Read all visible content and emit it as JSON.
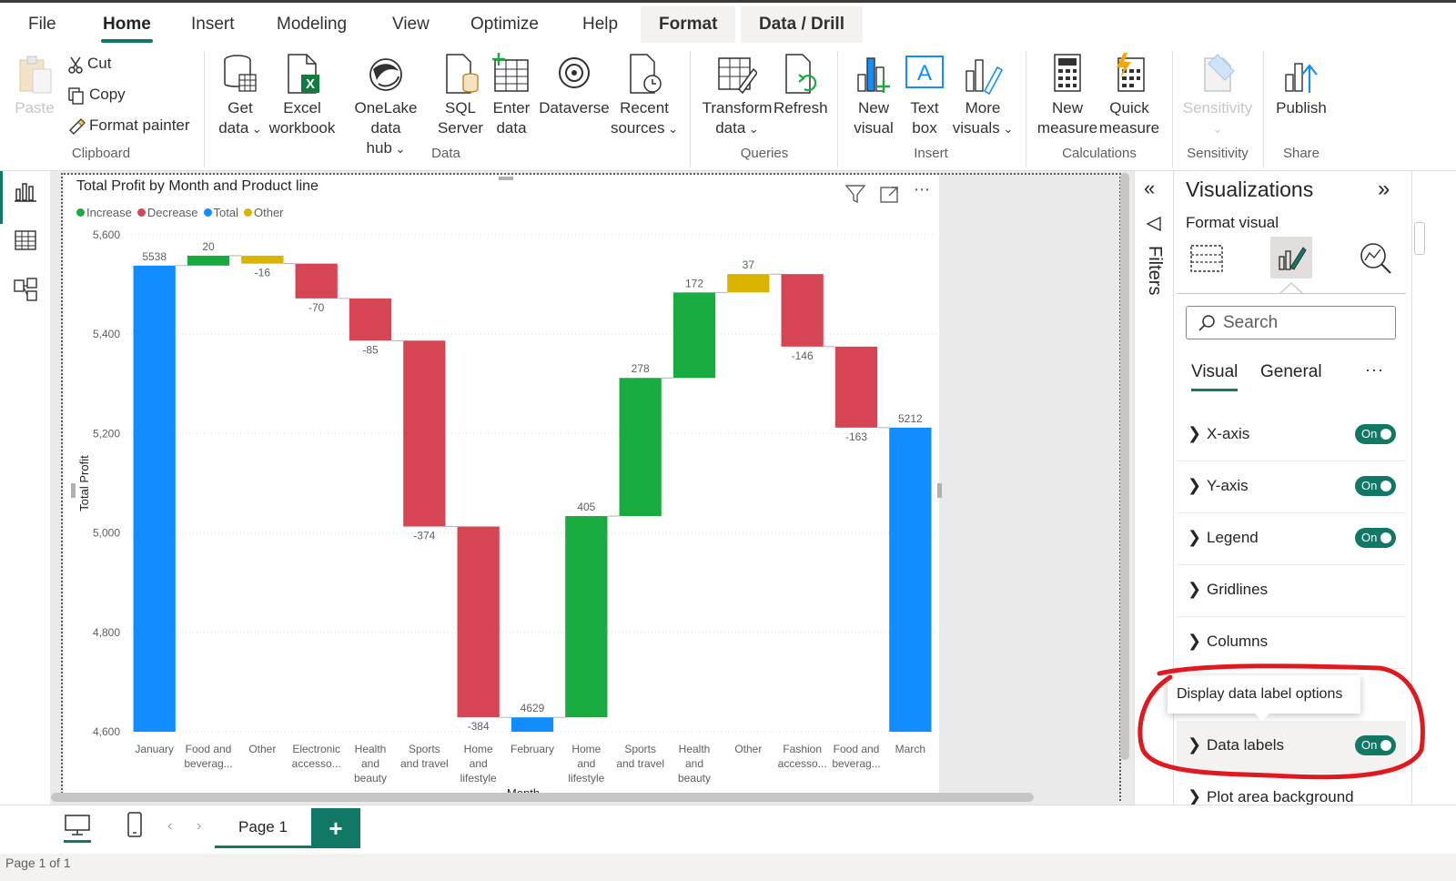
{
  "menu": {
    "tabs": [
      "File",
      "Home",
      "Insert",
      "Modeling",
      "View",
      "Optimize",
      "Help",
      "Format",
      "Data / Drill"
    ]
  },
  "ribbon": {
    "clipboard": {
      "paste": "Paste",
      "cut": "Cut",
      "copy": "Copy",
      "format_painter": "Format painter",
      "label": "Clipboard"
    },
    "data": {
      "get_data": [
        "Get",
        "data"
      ],
      "excel": [
        "Excel",
        "workbook"
      ],
      "onelake": [
        "OneLake data",
        "hub"
      ],
      "sql": [
        "SQL",
        "Server"
      ],
      "enter": [
        "Enter",
        "data"
      ],
      "dataverse": "Dataverse",
      "recent": [
        "Recent",
        "sources"
      ],
      "label": "Data"
    },
    "queries": {
      "transform": [
        "Transform",
        "data"
      ],
      "refresh": "Refresh",
      "label": "Queries"
    },
    "insert": {
      "new_visual": [
        "New",
        "visual"
      ],
      "text_box": [
        "Text",
        "box"
      ],
      "more_visuals": [
        "More",
        "visuals"
      ],
      "label": "Insert"
    },
    "calculations": {
      "new_measure": [
        "New",
        "measure"
      ],
      "quick_measure": [
        "Quick",
        "measure"
      ],
      "label": "Calculations"
    },
    "sensitivity": {
      "button": "Sensitivity",
      "label": "Sensitivity"
    },
    "share": {
      "publish": "Publish",
      "label": "Share"
    }
  },
  "visual": {
    "title": "Total Profit by Month and Product line",
    "legend": [
      {
        "name": "Increase",
        "color": "#1aab40"
      },
      {
        "name": "Decrease",
        "color": "#d64554"
      },
      {
        "name": "Total",
        "color": "#118dff"
      },
      {
        "name": "Other",
        "color": "#d9b300"
      }
    ],
    "x_axis_partial": "Month"
  },
  "chart_data": {
    "type": "bar",
    "subtype": "waterfall",
    "title": "Total Profit by Month and Product line",
    "ylabel": "Total Profit",
    "xlabel": "Month",
    "ylim": [
      4600,
      5600
    ],
    "yticks": [
      "5,600",
      "5,400",
      "5,200",
      "5,000",
      "4,800",
      "4,600"
    ],
    "ytick_values": [
      5600,
      5400,
      5200,
      5000,
      4800,
      4600
    ],
    "grid": true,
    "legend_position": "top-left",
    "categories": [
      [
        "January"
      ],
      [
        "Food and",
        "beverag..."
      ],
      [
        "Other"
      ],
      [
        "Electronic",
        "accesso..."
      ],
      [
        "Health",
        "and",
        "beauty"
      ],
      [
        "Sports",
        "and travel"
      ],
      [
        "Home",
        "and",
        "lifestyle"
      ],
      [
        "February"
      ],
      [
        "Home",
        "and",
        "lifestyle"
      ],
      [
        "Sports",
        "and travel"
      ],
      [
        "Health",
        "and",
        "beauty"
      ],
      [
        "Other"
      ],
      [
        "Fashion",
        "accesso..."
      ],
      [
        "Food and",
        "beverag..."
      ],
      [
        "March"
      ]
    ],
    "bars": [
      {
        "kind": "Total",
        "start": 4600,
        "end": 5538,
        "label": "5538"
      },
      {
        "kind": "Increase",
        "start": 5538,
        "end": 5558,
        "label": "20"
      },
      {
        "kind": "Other",
        "start": 5558,
        "end": 5542,
        "label": "-16"
      },
      {
        "kind": "Decrease",
        "start": 5542,
        "end": 5472,
        "label": "-70"
      },
      {
        "kind": "Decrease",
        "start": 5472,
        "end": 5387,
        "label": "-85"
      },
      {
        "kind": "Decrease",
        "start": 5387,
        "end": 5013,
        "label": "-374"
      },
      {
        "kind": "Decrease",
        "start": 5013,
        "end": 4629,
        "label": "-384"
      },
      {
        "kind": "Total",
        "start": 4600,
        "end": 4629,
        "label": "4629"
      },
      {
        "kind": "Increase",
        "start": 4629,
        "end": 5034,
        "label": "405"
      },
      {
        "kind": "Increase",
        "start": 5034,
        "end": 5312,
        "label": "278"
      },
      {
        "kind": "Increase",
        "start": 5312,
        "end": 5484,
        "label": "172"
      },
      {
        "kind": "Other",
        "start": 5484,
        "end": 5521,
        "label": "37"
      },
      {
        "kind": "Decrease",
        "start": 5521,
        "end": 5375,
        "label": "-146"
      },
      {
        "kind": "Decrease",
        "start": 5375,
        "end": 5212,
        "label": "-163"
      },
      {
        "kind": "Total",
        "start": 4600,
        "end": 5212,
        "label": "5212"
      }
    ]
  },
  "filters": {
    "label": "Filters"
  },
  "viz": {
    "title": "Visualizations",
    "format_visual": "Format visual",
    "search_placeholder": "Search",
    "tabs": [
      "Visual",
      "General"
    ],
    "more": "···",
    "sections": [
      {
        "label": "X-axis",
        "toggle": "On"
      },
      {
        "label": "Y-axis",
        "toggle": "On"
      },
      {
        "label": "Legend",
        "toggle": "On"
      },
      {
        "label": "Gridlines",
        "toggle": ""
      },
      {
        "label": "Columns",
        "toggle": ""
      },
      {
        "label": "Data labels",
        "toggle": "On"
      },
      {
        "label": "Plot area background",
        "toggle": ""
      }
    ],
    "tooltip": "Display data label options"
  },
  "bottom": {
    "page_tab": "Page 1",
    "add": "+",
    "status": "Page 1 of 1"
  },
  "colors": {
    "accent": "#117865",
    "annotation": "#e0191f"
  }
}
